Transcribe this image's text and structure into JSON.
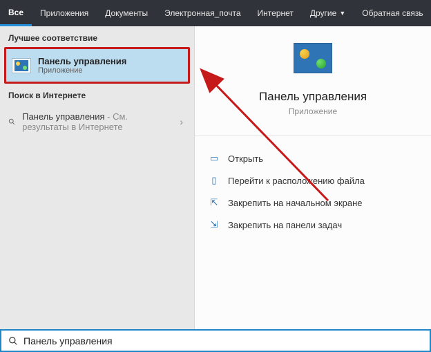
{
  "topbar": {
    "tabs": [
      {
        "label": "Все",
        "active": true
      },
      {
        "label": "Приложения",
        "active": false
      },
      {
        "label": "Документы",
        "active": false
      },
      {
        "label": "Электронная_почта",
        "active": false
      },
      {
        "label": "Интернет",
        "active": false
      },
      {
        "label": "Другие",
        "active": false,
        "dropdown": true
      }
    ],
    "feedback": "Обратная связь"
  },
  "left": {
    "best_match_header": "Лучшее соответствие",
    "best_match": {
      "title": "Панель управления",
      "subtitle": "Приложение"
    },
    "web_header": "Поиск в Интернете",
    "web_result": {
      "query": "Панель управления",
      "suffix": " - См. результаты в Интернете"
    }
  },
  "detail": {
    "title": "Панель управления",
    "subtitle": "Приложение",
    "actions": [
      {
        "icon": "open-icon",
        "label": "Открыть"
      },
      {
        "icon": "file-loc-icon",
        "label": "Перейти к расположению файла"
      },
      {
        "icon": "pin-start-icon",
        "label": "Закрепить на начальном экране"
      },
      {
        "icon": "pin-taskbar-icon",
        "label": "Закрепить на панели задач"
      }
    ]
  },
  "search": {
    "value": "Панель управления"
  }
}
